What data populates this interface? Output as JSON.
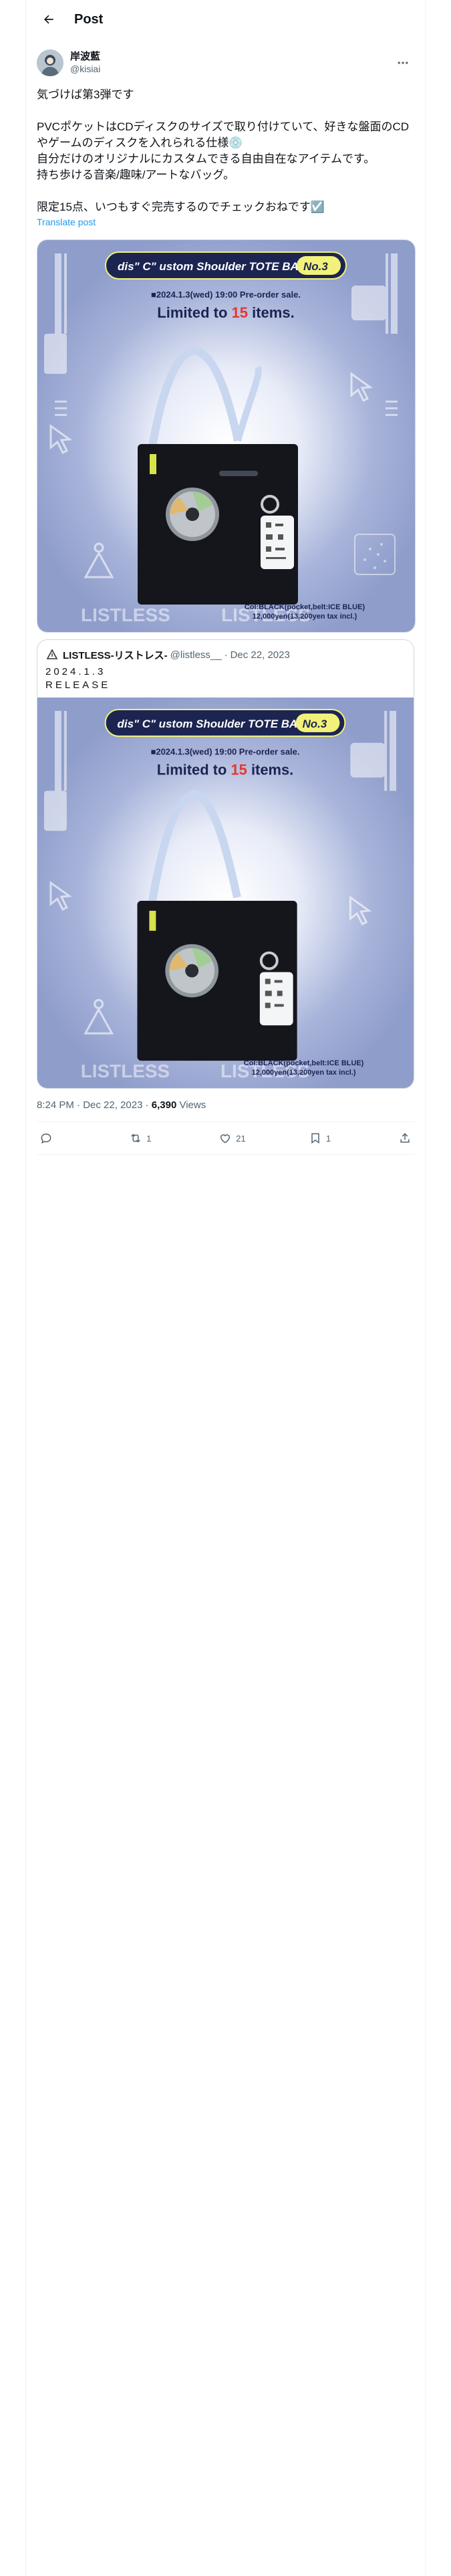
{
  "header": {
    "title": "Post"
  },
  "post": {
    "display_name": "岸波藍",
    "username": "@kisiai",
    "text": "気づけば第3弾です\n\nPVCポケットはCDディスクのサイズで取り付けていて、好きな盤面のCDやゲームのディスクを入れられる仕様💿\n自分だけのオリジナルにカスタムできる自由自在なアイテムです。\n持ち歩ける音楽/趣味/アートなバッグ。\n\n限定15点、いつもすぐ完売するのでチェックおねです☑️",
    "translate_label": "Translate post",
    "timestamp": "8:24 PM · Dec 22, 2023 · ",
    "views_count": "6,390",
    "views_label": " Views"
  },
  "product_image": {
    "title_pill": "dis\" C\" ustom Shoulder TOTE BAG",
    "number_badge": "No.3",
    "date_line": "■2024.1.3(wed) 19:00 Pre-order sale.",
    "limited_prefix": "Limited to ",
    "limited_number": "15",
    "limited_suffix": " items.",
    "brand_watermark": "LISTLESS",
    "col_line": "Col:BLACK(pocket,belt:ICE BLUE)",
    "price_line": "12,000yen(13,200yen tax incl.)",
    "colors": {
      "bg": "#8f9dcb",
      "glow": "#ffffff",
      "accent": "#f2f27a",
      "red": "#e8362d",
      "navy": "#1c2552"
    }
  },
  "quote": {
    "display_name": "LISTLESS-リストレス-",
    "username": "@listless__",
    "separator": "·",
    "date": "Dec 22, 2023",
    "text": "2024.1.3\nRELEASE"
  },
  "actions": {
    "reply_count": "",
    "repost_count": "1",
    "like_count": "21",
    "bookmark_count": "1"
  }
}
